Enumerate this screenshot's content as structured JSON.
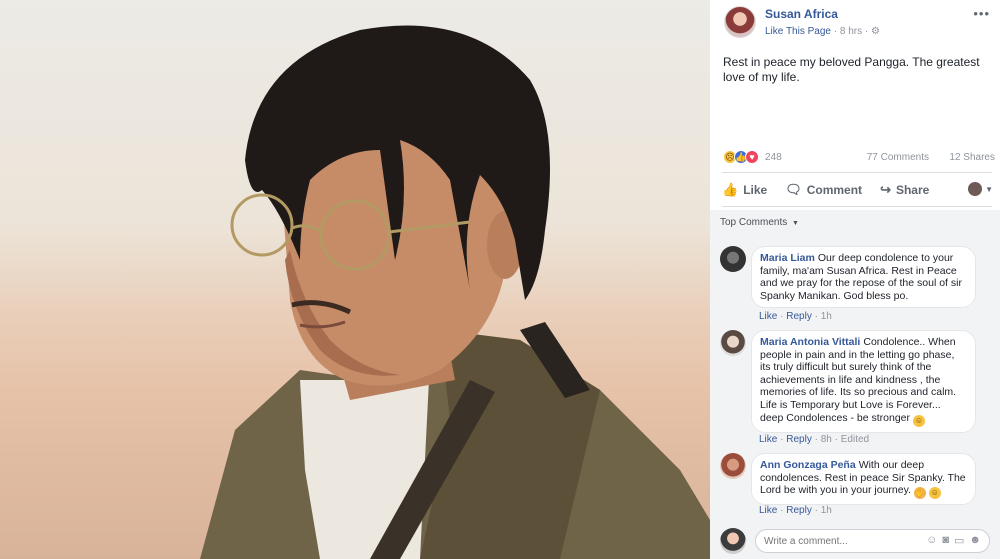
{
  "post": {
    "page_name": "Susan Africa",
    "like_page": "Like This Page",
    "time": "8 hrs",
    "privacy_icon": "globe-icon",
    "more_icon": "ellipsis-icon",
    "text": "Rest in peace my beloved Pangga. The greatest love of my life."
  },
  "stats": {
    "reactions": [
      "sad",
      "like",
      "love"
    ],
    "reaction_count": "248",
    "comments": "77 Comments",
    "shares": "12 Shares"
  },
  "actions": {
    "like": "Like",
    "comment": "Comment",
    "share": "Share"
  },
  "comments_header": "Top Comments",
  "comments": [
    {
      "author": "Maria Liam",
      "text": "Our deep condolence to your family, ma'am Susan Africa. Rest in Peace and we pray for the repose of the soul of sir Spanky Manikan. God bless po.",
      "like": "Like",
      "reply": "Reply",
      "time": "1h",
      "edited": ""
    },
    {
      "author": "Maria Antonia Vittali",
      "text": "Condolence.. When people in pain and in the letting go phase, its truly difficult but surely think of the achievements in life and kindness , the memories of life. Its so precious and calm. Life is Temporary but Love is Forever... deep Condolences - be stronger",
      "like": "Like",
      "reply": "Reply",
      "time": "8h",
      "edited": "Edited"
    },
    {
      "author": "Ann Gonzaga Peña",
      "text": "With our deep condolences. Rest in peace Sir Spanky. The Lord be with you in your journey.",
      "like": "Like",
      "reply": "Reply",
      "time": "1h",
      "edited": ""
    }
  ],
  "write_comment": {
    "placeholder": "Write a comment..."
  },
  "colors": {
    "link": "#365899",
    "muted": "#90949c",
    "comments_bg": "#f2f3f5"
  }
}
